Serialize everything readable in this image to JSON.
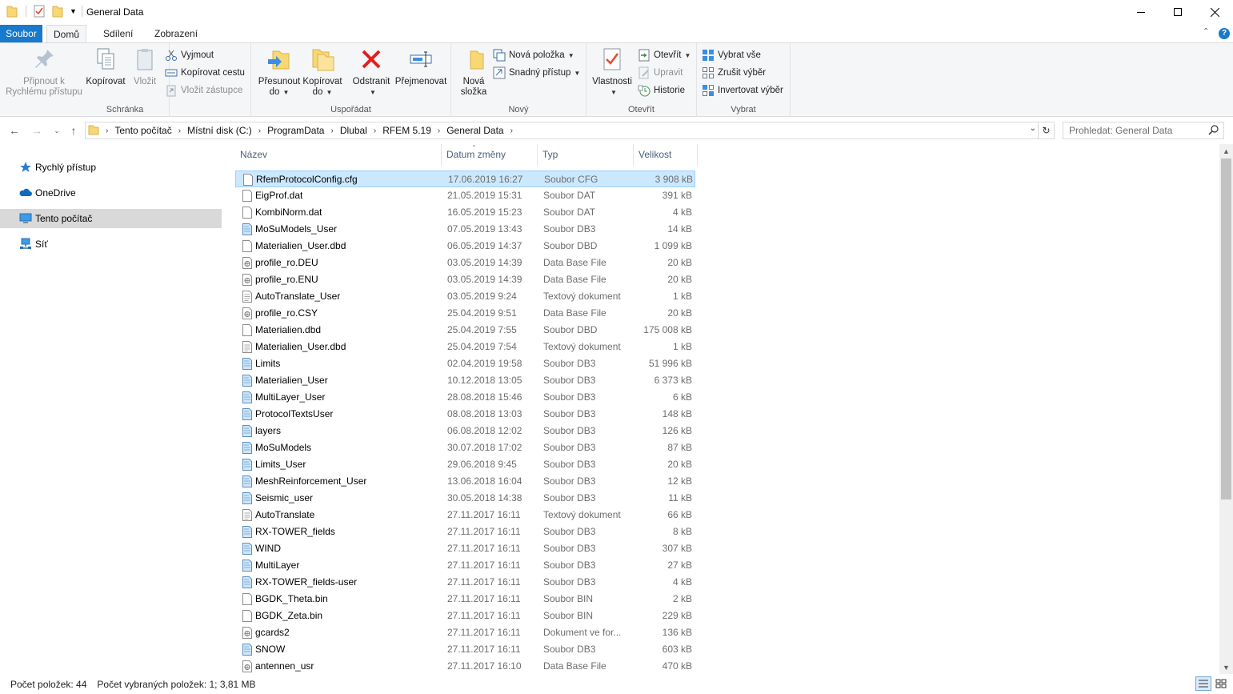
{
  "window": {
    "title": "General Data"
  },
  "ribbon_tabs": [
    {
      "label": "Soubor"
    },
    {
      "label": "Domů"
    },
    {
      "label": "Sdílení"
    },
    {
      "label": "Zobrazení"
    }
  ],
  "clipboard": {
    "group_label": "Schránka",
    "pin_line1": "Připnout k",
    "pin_line2": "Rychlému přístupu",
    "copy": "Kopírovat",
    "paste": "Vložit",
    "cut": "Vyjmout",
    "copy_path": "Kopírovat cestu",
    "paste_shortcut": "Vložit zástupce"
  },
  "organize": {
    "group_label": "Uspořádat",
    "move_line1": "Přesunout",
    "move_line2": "do",
    "copy_line1": "Kopírovat",
    "copy_line2": "do",
    "delete": "Odstranit",
    "rename": "Přejmenovat"
  },
  "new": {
    "group_label": "Nový",
    "folder_line1": "Nová",
    "folder_line2": "složka",
    "new_item": "Nová položka",
    "easy_access": "Snadný přístup"
  },
  "open": {
    "group_label": "Otevřít",
    "properties": "Vlastnosti",
    "open": "Otevřít",
    "edit": "Upravit",
    "history": "Historie"
  },
  "select": {
    "group_label": "Vybrat",
    "select_all": "Vybrat vše",
    "select_none": "Zrušit výběr",
    "invert": "Invertovat výběr"
  },
  "breadcrumb": [
    "Tento počítač",
    "Místní disk (C:)",
    "ProgramData",
    "Dlubal",
    "RFEM 5.19",
    "General Data"
  ],
  "search": {
    "placeholder": "Prohledat: General Data"
  },
  "sidebar": {
    "items": [
      {
        "label": "Rychlý přístup",
        "icon": "star-icon"
      },
      {
        "label": "OneDrive",
        "icon": "cloud-icon"
      },
      {
        "label": "Tento počítač",
        "icon": "computer-icon"
      },
      {
        "label": "Síť",
        "icon": "network-icon"
      }
    ]
  },
  "columns": {
    "name": "Název",
    "date": "Datum změny",
    "type": "Typ",
    "size": "Velikost"
  },
  "files": [
    {
      "name": "RfemProtocolConfig.cfg",
      "date": "17.06.2019 16:27",
      "type": "Soubor CFG",
      "size": "3 908 kB",
      "icon": "file-icon",
      "selected": true
    },
    {
      "name": "EigProf.dat",
      "date": "21.05.2019 15:31",
      "type": "Soubor DAT",
      "size": "391 kB",
      "icon": "file-icon"
    },
    {
      "name": "KombiNorm.dat",
      "date": "16.05.2019 15:23",
      "type": "Soubor DAT",
      "size": "4 kB",
      "icon": "file-icon"
    },
    {
      "name": "MoSuModels_User",
      "date": "07.05.2019 13:43",
      "type": "Soubor DB3",
      "size": "14 kB",
      "icon": "db-icon"
    },
    {
      "name": "Materialien_User.dbd",
      "date": "06.05.2019 14:37",
      "type": "Soubor DBD",
      "size": "1 099 kB",
      "icon": "file-icon"
    },
    {
      "name": "profile_ro.DEU",
      "date": "03.05.2019 14:39",
      "type": "Data Base File",
      "size": "20 kB",
      "icon": "database-file-icon"
    },
    {
      "name": "profile_ro.ENU",
      "date": "03.05.2019 14:39",
      "type": "Data Base File",
      "size": "20 kB",
      "icon": "database-file-icon"
    },
    {
      "name": "AutoTranslate_User",
      "date": "03.05.2019 9:24",
      "type": "Textový dokument",
      "size": "1 kB",
      "icon": "text-file-icon"
    },
    {
      "name": "profile_ro.CSY",
      "date": "25.04.2019 9:51",
      "type": "Data Base File",
      "size": "20 kB",
      "icon": "database-file-icon"
    },
    {
      "name": "Materialien.dbd",
      "date": "25.04.2019 7:55",
      "type": "Soubor DBD",
      "size": "175 008 kB",
      "icon": "file-icon"
    },
    {
      "name": "Materialien_User.dbd",
      "date": "25.04.2019 7:54",
      "type": "Textový dokument",
      "size": "1 kB",
      "icon": "text-file-icon"
    },
    {
      "name": "Limits",
      "date": "02.04.2019 19:58",
      "type": "Soubor DB3",
      "size": "51 996 kB",
      "icon": "db-icon"
    },
    {
      "name": "Materialien_User",
      "date": "10.12.2018 13:05",
      "type": "Soubor DB3",
      "size": "6 373 kB",
      "icon": "db-icon"
    },
    {
      "name": "MultiLayer_User",
      "date": "28.08.2018 15:46",
      "type": "Soubor DB3",
      "size": "6 kB",
      "icon": "db-icon"
    },
    {
      "name": "ProtocolTextsUser",
      "date": "08.08.2018 13:03",
      "type": "Soubor DB3",
      "size": "148 kB",
      "icon": "db-icon"
    },
    {
      "name": "layers",
      "date": "06.08.2018 12:02",
      "type": "Soubor DB3",
      "size": "126 kB",
      "icon": "db-icon"
    },
    {
      "name": "MoSuModels",
      "date": "30.07.2018 17:02",
      "type": "Soubor DB3",
      "size": "87 kB",
      "icon": "db-icon"
    },
    {
      "name": "Limits_User",
      "date": "29.06.2018 9:45",
      "type": "Soubor DB3",
      "size": "20 kB",
      "icon": "db-icon"
    },
    {
      "name": "MeshReinforcement_User",
      "date": "13.06.2018 16:04",
      "type": "Soubor DB3",
      "size": "12 kB",
      "icon": "db-icon"
    },
    {
      "name": "Seismic_user",
      "date": "30.05.2018 14:38",
      "type": "Soubor DB3",
      "size": "11 kB",
      "icon": "db-icon"
    },
    {
      "name": "AutoTranslate",
      "date": "27.11.2017 16:11",
      "type": "Textový dokument",
      "size": "66 kB",
      "icon": "text-file-icon"
    },
    {
      "name": "RX-TOWER_fields",
      "date": "27.11.2017 16:11",
      "type": "Soubor DB3",
      "size": "8 kB",
      "icon": "db-icon"
    },
    {
      "name": "WIND",
      "date": "27.11.2017 16:11",
      "type": "Soubor DB3",
      "size": "307 kB",
      "icon": "db-icon"
    },
    {
      "name": "MultiLayer",
      "date": "27.11.2017 16:11",
      "type": "Soubor DB3",
      "size": "27 kB",
      "icon": "db-icon"
    },
    {
      "name": "RX-TOWER_fields-user",
      "date": "27.11.2017 16:11",
      "type": "Soubor DB3",
      "size": "4 kB",
      "icon": "db-icon"
    },
    {
      "name": "BGDK_Theta.bin",
      "date": "27.11.2017 16:11",
      "type": "Soubor BIN",
      "size": "2 kB",
      "icon": "file-icon"
    },
    {
      "name": "BGDK_Zeta.bin",
      "date": "27.11.2017 16:11",
      "type": "Soubor BIN",
      "size": "229 kB",
      "icon": "file-icon"
    },
    {
      "name": "gcards2",
      "date": "27.11.2017 16:11",
      "type": "Dokument ve for...",
      "size": "136 kB",
      "icon": "database-file-icon"
    },
    {
      "name": "SNOW",
      "date": "27.11.2017 16:11",
      "type": "Soubor DB3",
      "size": "603 kB",
      "icon": "db-icon"
    },
    {
      "name": "antennen_usr",
      "date": "27.11.2017 16:10",
      "type": "Data Base File",
      "size": "470 kB",
      "icon": "database-file-icon"
    }
  ],
  "status": {
    "item_count": "Počet položek: 44",
    "selected": "Počet vybraných položek: 1; 3,81 MB"
  },
  "colors": {
    "accent": "#1979ca",
    "selection": "#cce8ff",
    "selection_border": "#99d1ff",
    "nav_selected": "#d9d9d9",
    "ribbon_bg": "#f5f6f7"
  }
}
